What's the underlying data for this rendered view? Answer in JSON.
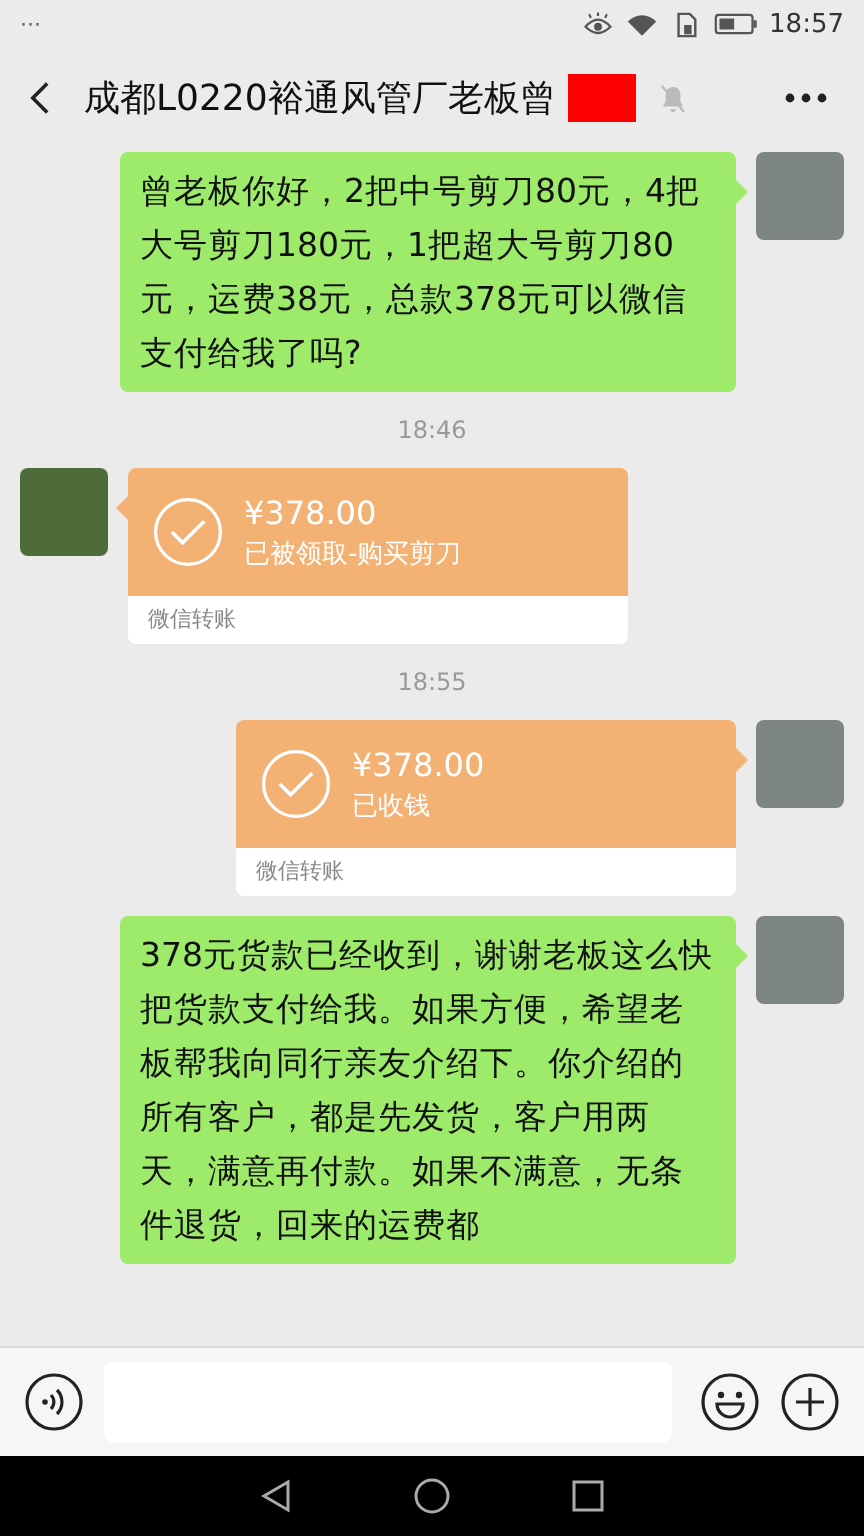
{
  "status_bar": {
    "notifications": "···",
    "time": "18:57"
  },
  "header": {
    "title": "成都L0220裕通风管厂老板曾",
    "redacted": true,
    "muted": true
  },
  "messages": [
    {
      "kind": "text",
      "outgoing": true,
      "text": "曾老板你好，2把中号剪刀80元，4把大号剪刀180元，1把超大号剪刀80元，运费38元，总款378元可以微信支付给我了吗?"
    },
    {
      "kind": "time",
      "text": "18:46"
    },
    {
      "kind": "transfer",
      "outgoing": false,
      "amount": "¥378.00",
      "status": "已被领取-购买剪刀",
      "footer": "微信转账"
    },
    {
      "kind": "time",
      "text": "18:55"
    },
    {
      "kind": "transfer",
      "outgoing": true,
      "amount": "¥378.00",
      "status": "已收钱",
      "footer": "微信转账"
    },
    {
      "kind": "text",
      "outgoing": true,
      "text": "378元货款已经收到，谢谢老板这么快把货款支付给我。如果方便，希望老板帮我向同行亲友介绍下。你介绍的所有客户，都是先发货，客户用两天，满意再付款。如果不满意，无条件退货，回来的运费都"
    }
  ]
}
